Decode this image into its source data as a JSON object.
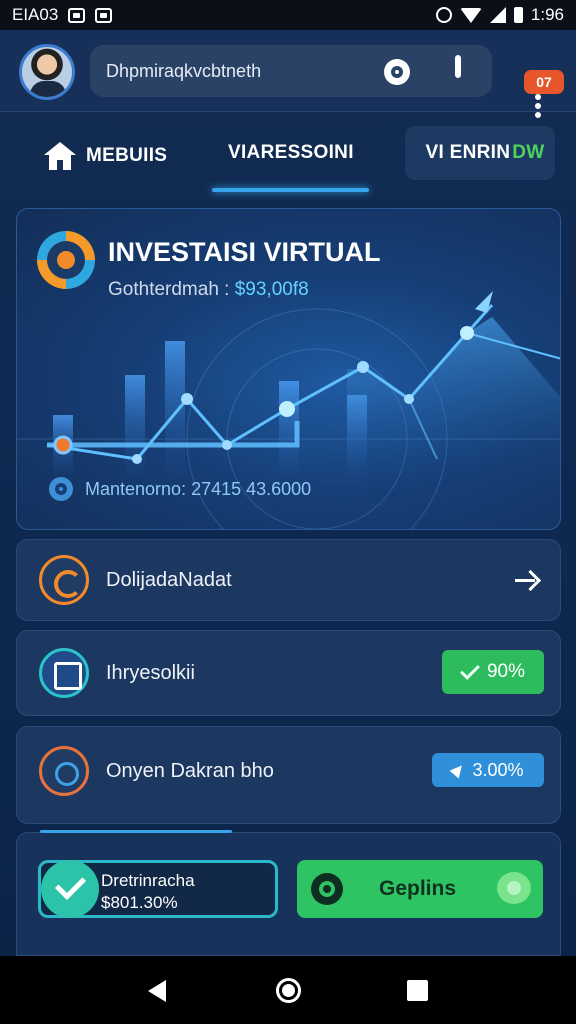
{
  "status_bar": {
    "left_text": "EIA03",
    "time": "1:96"
  },
  "header": {
    "search_text": "Dhpmiraqkvcbtneth",
    "notification_badge": "07",
    "icons": [
      "avatar",
      "gear-icon",
      "lock-icon",
      "more-vert-icon"
    ]
  },
  "tabs": [
    {
      "label": "MEBUIIS"
    },
    {
      "label": "VIARESSOINI"
    },
    {
      "label_prefix": "VI ENRIN",
      "label_accent": "DW"
    }
  ],
  "hero": {
    "title": "INVESTAISI VIRTUAL",
    "subtitle_label": "Gothterdmah :",
    "subtitle_value": "$93,00f8",
    "footer_text": "Mantenorno: 27415 43.6000"
  },
  "list": [
    {
      "label": "DolijadaNadat",
      "icon": "phone-off-icon"
    },
    {
      "label": "Ihryesolkii",
      "icon": "device-icon",
      "badge": "90%"
    },
    {
      "label": "Onyen Dakran bho",
      "icon": "target-icon",
      "badge": "3.00%"
    }
  ],
  "bottom": {
    "stat_title": "Dretrinracha",
    "stat_value": "$801.30%",
    "button_label": "Geplins"
  },
  "colors": {
    "accent_blue": "#36a4e8",
    "green": "#2ec363",
    "orange": "#f08a2a",
    "bg": "#0f2545"
  }
}
